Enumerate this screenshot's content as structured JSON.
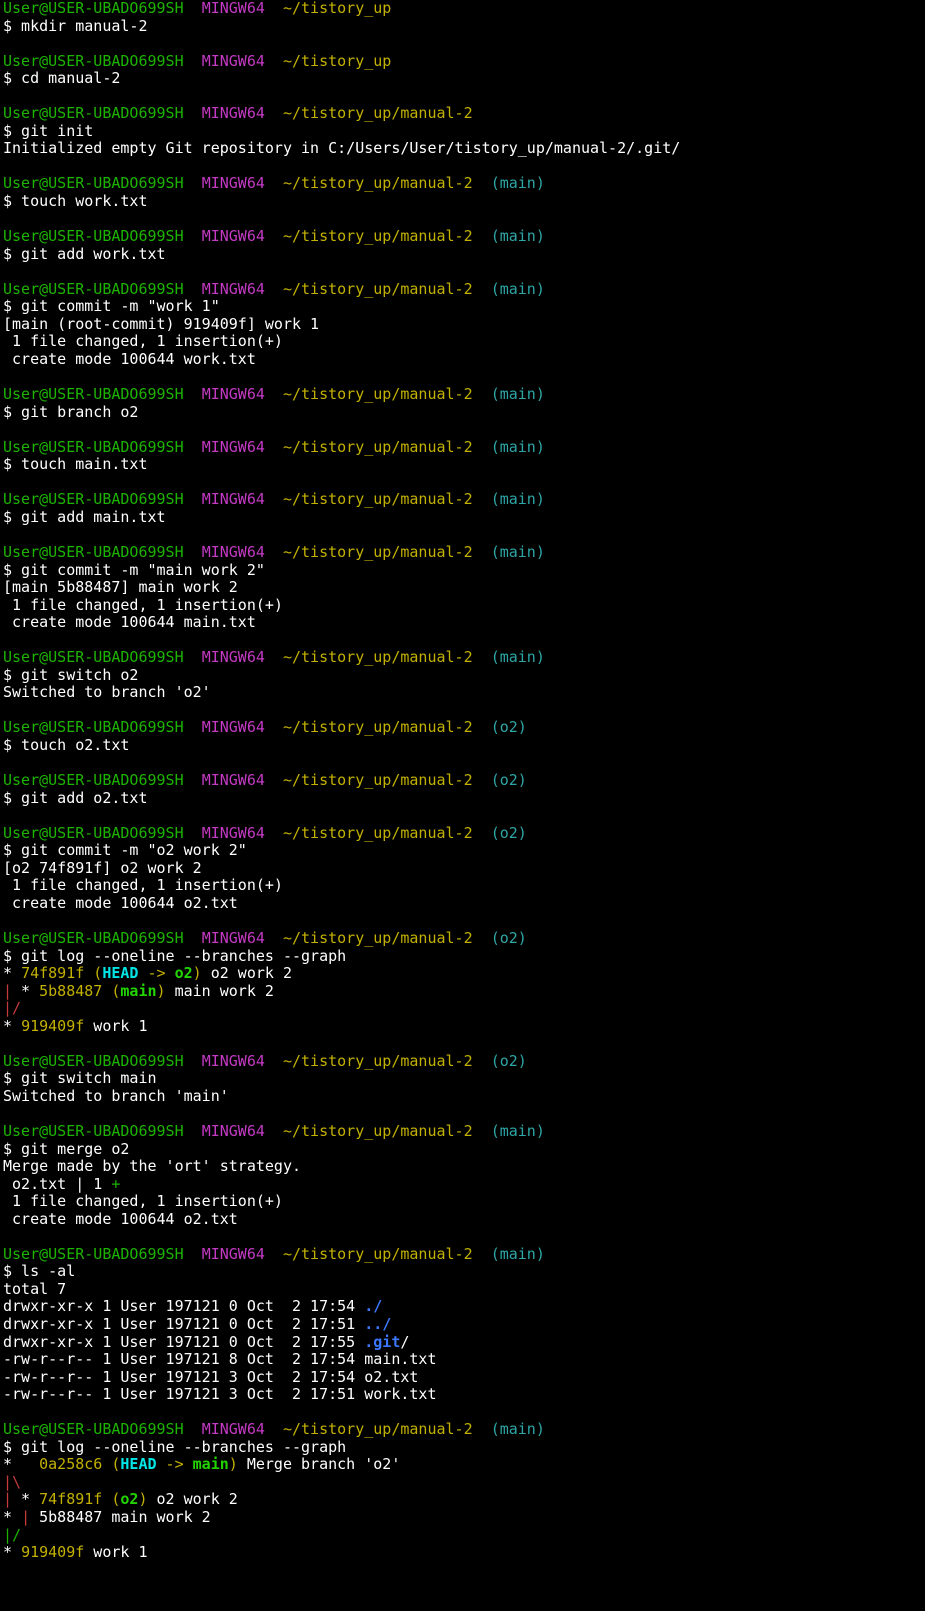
{
  "colors": {
    "background": "#000000",
    "text": "#ffffff",
    "user": "#1db400",
    "host": "#c43ac4",
    "path": "#c2b100",
    "branch": "#2fa6a6",
    "head": "#00e6e6",
    "graph_red": "#c43a3a",
    "dir_blue": "#3b78ff"
  },
  "lines": [
    [
      [
        "c-user",
        "User@USER-UBADO699SH"
      ],
      [
        "",
        "  "
      ],
      [
        "c-host",
        "MINGW64"
      ],
      [
        "",
        "  "
      ],
      [
        "c-path",
        "~/tistory_up"
      ]
    ],
    [
      [
        "",
        "$ mkdir manual-2"
      ]
    ],
    [
      [
        "",
        ""
      ]
    ],
    [
      [
        "c-user",
        "User@USER-UBADO699SH"
      ],
      [
        "",
        "  "
      ],
      [
        "c-host",
        "MINGW64"
      ],
      [
        "",
        "  "
      ],
      [
        "c-path",
        "~/tistory_up"
      ]
    ],
    [
      [
        "",
        "$ cd manual-2"
      ]
    ],
    [
      [
        "",
        ""
      ]
    ],
    [
      [
        "c-user",
        "User@USER-UBADO699SH"
      ],
      [
        "",
        "  "
      ],
      [
        "c-host",
        "MINGW64"
      ],
      [
        "",
        "  "
      ],
      [
        "c-path",
        "~/tistory_up/manual-2"
      ]
    ],
    [
      [
        "",
        "$ git init"
      ]
    ],
    [
      [
        "",
        "Initialized empty Git repository in C:/Users/User/tistory_up/manual-2/.git/"
      ]
    ],
    [
      [
        "",
        ""
      ]
    ],
    [
      [
        "c-user",
        "User@USER-UBADO699SH"
      ],
      [
        "",
        "  "
      ],
      [
        "c-host",
        "MINGW64"
      ],
      [
        "",
        "  "
      ],
      [
        "c-path",
        "~/tistory_up/manual-2"
      ],
      [
        "",
        "  "
      ],
      [
        "c-branch",
        "(main)"
      ]
    ],
    [
      [
        "",
        "$ touch work.txt"
      ]
    ],
    [
      [
        "",
        ""
      ]
    ],
    [
      [
        "c-user",
        "User@USER-UBADO699SH"
      ],
      [
        "",
        "  "
      ],
      [
        "c-host",
        "MINGW64"
      ],
      [
        "",
        "  "
      ],
      [
        "c-path",
        "~/tistory_up/manual-2"
      ],
      [
        "",
        "  "
      ],
      [
        "c-branch",
        "(main)"
      ]
    ],
    [
      [
        "",
        "$ git add work.txt"
      ]
    ],
    [
      [
        "",
        ""
      ]
    ],
    [
      [
        "c-user",
        "User@USER-UBADO699SH"
      ],
      [
        "",
        "  "
      ],
      [
        "c-host",
        "MINGW64"
      ],
      [
        "",
        "  "
      ],
      [
        "c-path",
        "~/tistory_up/manual-2"
      ],
      [
        "",
        "  "
      ],
      [
        "c-branch",
        "(main)"
      ]
    ],
    [
      [
        "",
        "$ git commit -m \"work 1\""
      ]
    ],
    [
      [
        "",
        "[main (root-commit) 919409f] work 1"
      ]
    ],
    [
      [
        "",
        "",
        " 1 file changed, 1 insertion(+)"
      ]
    ],
    [
      [
        "",
        " create mode 100644 work.txt"
      ]
    ],
    [
      [
        "",
        ""
      ]
    ],
    [
      [
        "c-user",
        "User@USER-UBADO699SH"
      ],
      [
        "",
        "  "
      ],
      [
        "c-host",
        "MINGW64"
      ],
      [
        "",
        "  "
      ],
      [
        "c-path",
        "~/tistory_up/manual-2"
      ],
      [
        "",
        "  "
      ],
      [
        "c-branch",
        "(main)"
      ]
    ],
    [
      [
        "",
        "$ git branch o2"
      ]
    ],
    [
      [
        "",
        ""
      ]
    ],
    [
      [
        "c-user",
        "User@USER-UBADO699SH"
      ],
      [
        "",
        "  "
      ],
      [
        "c-host",
        "MINGW64"
      ],
      [
        "",
        "  "
      ],
      [
        "c-path",
        "~/tistory_up/manual-2"
      ],
      [
        "",
        "  "
      ],
      [
        "c-branch",
        "(main)"
      ]
    ],
    [
      [
        "",
        "$ touch main.txt"
      ]
    ],
    [
      [
        "",
        ""
      ]
    ],
    [
      [
        "c-user",
        "User@USER-UBADO699SH"
      ],
      [
        "",
        "  "
      ],
      [
        "c-host",
        "MINGW64"
      ],
      [
        "",
        "  "
      ],
      [
        "c-path",
        "~/tistory_up/manual-2"
      ],
      [
        "",
        "  "
      ],
      [
        "c-branch",
        "(main)"
      ]
    ],
    [
      [
        "",
        "$ git add main.txt"
      ]
    ],
    [
      [
        "",
        ""
      ]
    ],
    [
      [
        "c-user",
        "User@USER-UBADO699SH"
      ],
      [
        "",
        "  "
      ],
      [
        "c-host",
        "MINGW64"
      ],
      [
        "",
        "  "
      ],
      [
        "c-path",
        "~/tistory_up/manual-2"
      ],
      [
        "",
        "  "
      ],
      [
        "c-branch",
        "(main)"
      ]
    ],
    [
      [
        "",
        "$ git commit -m \"main work 2\""
      ]
    ],
    [
      [
        "",
        "[main 5b88487] main work 2"
      ]
    ],
    [
      [
        "",
        " 1 file changed, 1 insertion(+)"
      ]
    ],
    [
      [
        "",
        " create mode 100644 main.txt"
      ]
    ],
    [
      [
        "",
        ""
      ]
    ],
    [
      [
        "c-user",
        "User@USER-UBADO699SH"
      ],
      [
        "",
        "  "
      ],
      [
        "c-host",
        "MINGW64"
      ],
      [
        "",
        "  "
      ],
      [
        "c-path",
        "~/tistory_up/manual-2"
      ],
      [
        "",
        "  "
      ],
      [
        "c-branch",
        "(main)"
      ]
    ],
    [
      [
        "",
        "$ git switch o2"
      ]
    ],
    [
      [
        "",
        "Switched to branch 'o2'"
      ]
    ],
    [
      [
        "",
        ""
      ]
    ],
    [
      [
        "c-user",
        "User@USER-UBADO699SH"
      ],
      [
        "",
        "  "
      ],
      [
        "c-host",
        "MINGW64"
      ],
      [
        "",
        "  "
      ],
      [
        "c-path",
        "~/tistory_up/manual-2"
      ],
      [
        "",
        "  "
      ],
      [
        "c-branch",
        "(o2)"
      ]
    ],
    [
      [
        "",
        "$ touch o2.txt"
      ]
    ],
    [
      [
        "",
        ""
      ]
    ],
    [
      [
        "c-user",
        "User@USER-UBADO699SH"
      ],
      [
        "",
        "  "
      ],
      [
        "c-host",
        "MINGW64"
      ],
      [
        "",
        "  "
      ],
      [
        "c-path",
        "~/tistory_up/manual-2"
      ],
      [
        "",
        "  "
      ],
      [
        "c-branch",
        "(o2)"
      ]
    ],
    [
      [
        "",
        "$ git add o2.txt"
      ]
    ],
    [
      [
        "",
        ""
      ]
    ],
    [
      [
        "c-user",
        "User@USER-UBADO699SH"
      ],
      [
        "",
        "  "
      ],
      [
        "c-host",
        "MINGW64"
      ],
      [
        "",
        "  "
      ],
      [
        "c-path",
        "~/tistory_up/manual-2"
      ],
      [
        "",
        "  "
      ],
      [
        "c-branch",
        "(o2)"
      ]
    ],
    [
      [
        "",
        "$ git commit -m \"o2 work 2\""
      ]
    ],
    [
      [
        "",
        "[o2 74f891f] o2 work 2"
      ]
    ],
    [
      [
        "",
        " 1 file changed, 1 insertion(+)"
      ]
    ],
    [
      [
        "",
        " create mode 100644 o2.txt"
      ]
    ],
    [
      [
        "",
        ""
      ]
    ],
    [
      [
        "c-user",
        "User@USER-UBADO699SH"
      ],
      [
        "",
        "  "
      ],
      [
        "c-host",
        "MINGW64"
      ],
      [
        "",
        "  "
      ],
      [
        "c-path",
        "~/tistory_up/manual-2"
      ],
      [
        "",
        "  "
      ],
      [
        "c-branch",
        "(o2)"
      ]
    ],
    [
      [
        "",
        "$ git log --oneline --branches --graph"
      ]
    ],
    [
      [
        "",
        "* "
      ],
      [
        "c-yellow",
        "74f891f ("
      ],
      [
        "c-cyanb",
        "HEAD"
      ],
      [
        "c-yellow",
        " -> "
      ],
      [
        "c-greenb",
        "o2"
      ],
      [
        "c-yellow",
        ")"
      ],
      [
        "",
        " o2 work 2"
      ]
    ],
    [
      [
        "c-red",
        "|"
      ],
      [
        "",
        " * "
      ],
      [
        "c-yellow",
        "5b88487 ("
      ],
      [
        "c-greenb",
        "main"
      ],
      [
        "c-yellow",
        ")"
      ],
      [
        "",
        " main work 2"
      ]
    ],
    [
      [
        "c-red",
        "|/"
      ]
    ],
    [
      [
        "",
        "* "
      ],
      [
        "c-yellow",
        "919409f"
      ],
      [
        "",
        " work 1"
      ]
    ],
    [
      [
        "",
        ""
      ]
    ],
    [
      [
        "c-user",
        "User@USER-UBADO699SH"
      ],
      [
        "",
        "  "
      ],
      [
        "c-host",
        "MINGW64"
      ],
      [
        "",
        "  "
      ],
      [
        "c-path",
        "~/tistory_up/manual-2"
      ],
      [
        "",
        "  "
      ],
      [
        "c-branch",
        "(o2)"
      ]
    ],
    [
      [
        "",
        "$ git switch main"
      ]
    ],
    [
      [
        "",
        "Switched to branch 'main'"
      ]
    ],
    [
      [
        "",
        ""
      ]
    ],
    [
      [
        "c-user",
        "User@USER-UBADO699SH"
      ],
      [
        "",
        "  "
      ],
      [
        "c-host",
        "MINGW64"
      ],
      [
        "",
        "  "
      ],
      [
        "c-path",
        "~/tistory_up/manual-2"
      ],
      [
        "",
        "  "
      ],
      [
        "c-branch",
        "(main)"
      ]
    ],
    [
      [
        "",
        "$ git merge o2"
      ]
    ],
    [
      [
        "",
        "Merge made by the 'ort' strategy."
      ]
    ],
    [
      [
        "",
        " o2.txt | 1 "
      ],
      [
        "c-green",
        "+"
      ]
    ],
    [
      [
        "",
        " 1 file changed, 1 insertion(+)"
      ]
    ],
    [
      [
        "",
        " create mode 100644 o2.txt"
      ]
    ],
    [
      [
        "",
        ""
      ]
    ],
    [
      [
        "c-user",
        "User@USER-UBADO699SH"
      ],
      [
        "",
        "  "
      ],
      [
        "c-host",
        "MINGW64"
      ],
      [
        "",
        "  "
      ],
      [
        "c-path",
        "~/tistory_up/manual-2"
      ],
      [
        "",
        "  "
      ],
      [
        "c-branch",
        "(main)"
      ]
    ],
    [
      [
        "",
        "$ ls -al"
      ]
    ],
    [
      [
        "",
        "total 7"
      ]
    ],
    [
      [
        "",
        "drwxr-xr-x 1 User 197121 0 Oct  2 17:54 "
      ],
      [
        "c-blueb",
        "./"
      ]
    ],
    [
      [
        "",
        "drwxr-xr-x 1 User 197121 0 Oct  2 17:51 "
      ],
      [
        "c-blueb",
        "../"
      ]
    ],
    [
      [
        "",
        "drwxr-xr-x 1 User 197121 0 Oct  2 17:55 "
      ],
      [
        "c-blueb",
        ".git"
      ],
      [
        "",
        "/"
      ]
    ],
    [
      [
        "",
        "-rw-r--r-- 1 User 197121 8 Oct  2 17:54 main.txt"
      ]
    ],
    [
      [
        "",
        "-rw-r--r-- 1 User 197121 3 Oct  2 17:54 o2.txt"
      ]
    ],
    [
      [
        "",
        "-rw-r--r-- 1 User 197121 3 Oct  2 17:51 work.txt"
      ]
    ],
    [
      [
        "",
        ""
      ]
    ],
    [
      [
        "c-user",
        "User@USER-UBADO699SH"
      ],
      [
        "",
        "  "
      ],
      [
        "c-host",
        "MINGW64"
      ],
      [
        "",
        "  "
      ],
      [
        "c-path",
        "~/tistory_up/manual-2"
      ],
      [
        "",
        "  "
      ],
      [
        "c-branch",
        "(main)"
      ]
    ],
    [
      [
        "",
        "$ git log --oneline --branches --graph"
      ]
    ],
    [
      [
        "",
        "*   "
      ],
      [
        "c-yellow",
        "0a258c6 ("
      ],
      [
        "c-cyanb",
        "HEAD"
      ],
      [
        "c-yellow",
        " -> "
      ],
      [
        "c-greenb",
        "main"
      ],
      [
        "c-yellow",
        ")"
      ],
      [
        "",
        " Merge branch 'o2'"
      ]
    ],
    [
      [
        "c-red",
        "|\\"
      ]
    ],
    [
      [
        "c-red",
        "|"
      ],
      [
        "",
        " * "
      ],
      [
        "c-yellow",
        "74f891f ("
      ],
      [
        "c-greenb",
        "o2"
      ],
      [
        "c-yellow",
        ")"
      ],
      [
        "",
        " o2 work 2"
      ]
    ],
    [
      [
        "",
        "* "
      ],
      [
        "c-red",
        "|"
      ],
      [
        "",
        "",
        " 5b88487"
      ],
      [
        "",
        " main work 2"
      ]
    ],
    [
      [
        "c-green",
        "|/"
      ]
    ],
    [
      [
        "",
        "* "
      ],
      [
        "c-yellow",
        "919409f"
      ],
      [
        "",
        " work 1"
      ]
    ]
  ]
}
